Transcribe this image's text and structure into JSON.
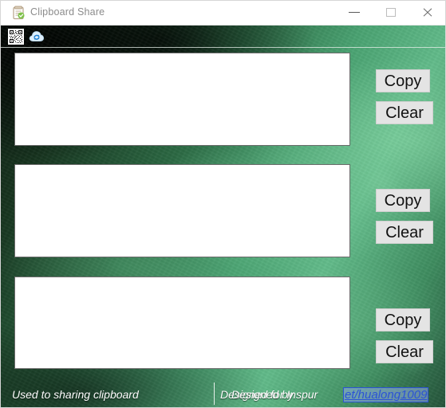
{
  "window": {
    "title": "Clipboard Share",
    "title_icon": "clipboard-icon",
    "controls": {
      "minimize": "minimize-icon",
      "maximize": "maximize-icon",
      "close": "close-icon"
    }
  },
  "toolbar": {
    "items": [
      {
        "name": "qr-code-icon",
        "label": "QR Code"
      },
      {
        "name": "cloud-sync-icon",
        "label": "Cloud Sync"
      }
    ]
  },
  "panels": [
    {
      "textarea_value": "",
      "textarea_placeholder": "",
      "copy_label": "Copy",
      "clear_label": "Clear"
    },
    {
      "textarea_value": "",
      "textarea_placeholder": "",
      "copy_label": "Copy",
      "clear_label": "Clear"
    },
    {
      "textarea_value": "",
      "textarea_placeholder": "",
      "copy_label": "Copy",
      "clear_label": "Clear"
    }
  ],
  "status": {
    "left_text": "Used to sharing clipboard",
    "credit_primary": "Designed for Inspur",
    "credit_secondary": "Designed by",
    "link_text": "et/hualong1009"
  },
  "colors": {
    "titlebar_bg": "#ffffff",
    "title_text": "#8b8b8b",
    "button_bg": "#e4e4e4",
    "button_text": "#111111",
    "textarea_bg": "#ffffff",
    "textarea_border": "#6b6b6b",
    "status_text": "#ffffff",
    "link_color": "#2b53d6",
    "photo_dark_green": "#17341f",
    "photo_light_green": "#62bb8a"
  }
}
